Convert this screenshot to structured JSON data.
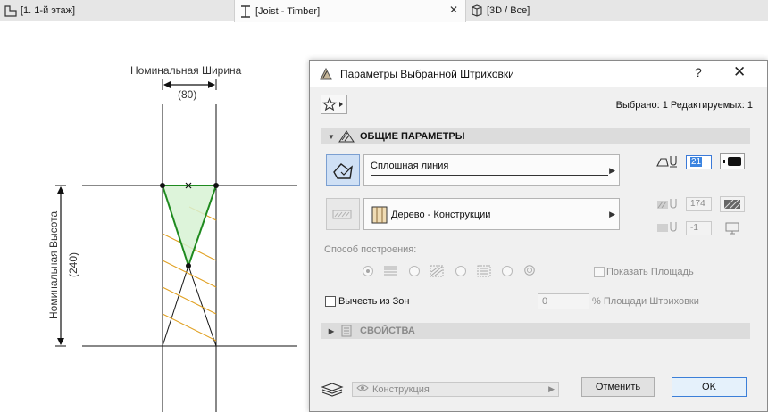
{
  "tabs": [
    {
      "label": "[1. 1-й этаж]",
      "icon": "floor-plan-icon",
      "active": false
    },
    {
      "label": "[Joist - Timber]",
      "icon": "beam-section-icon",
      "active": true,
      "close": "✕"
    },
    {
      "label": "[3D / Все]",
      "icon": "cube-3d-icon",
      "active": false
    }
  ],
  "drawing": {
    "width_label": "Номинальная Ширина",
    "width_value": "(80)",
    "height_label": "Номинальная Высота",
    "height_value": "(240)",
    "colors": {
      "fill": "#d7f2d3",
      "outline": "#1f8a1f",
      "hatch": "#e0a020",
      "lines": "#111111"
    }
  },
  "dialog": {
    "title": "Параметры Выбранной Штриховки",
    "help": "?",
    "close": "✕",
    "selection_info": "Выбрано: 1 Редактируемых: 1",
    "general_section": "ОБЩИЕ ПАРАМЕТРЫ",
    "line_type": "Сплошная линия",
    "pen_value": "21",
    "fill_type": "Дерево - Конструкции",
    "fill_pen_value": "174",
    "bg_pen_value": "-1",
    "construction_method_label": "Способ построения:",
    "show_area_label": "Показать Площадь",
    "subtract_zones_label": "Вычесть из Зон",
    "area_percent_value": "0",
    "area_percent_label": "% Площади Штриховки",
    "properties_section": "СВОЙСТВА",
    "layer_value": "Конструкция",
    "cancel_label": "Отменить",
    "ok_label": "OK"
  }
}
